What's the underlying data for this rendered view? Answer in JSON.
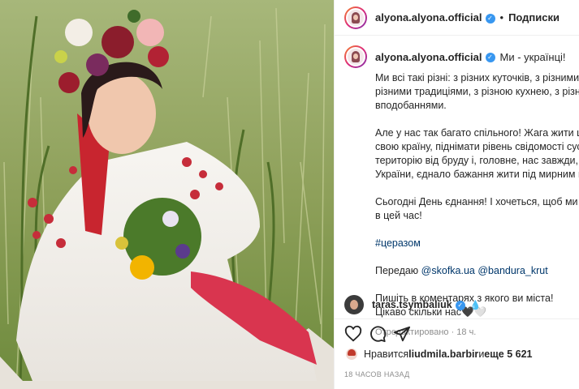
{
  "post": {
    "author": "alyona.alyona.official",
    "follow_label": "Подписки",
    "separator": "•",
    "verified_mark": "✓"
  },
  "caption": {
    "title": "Ми - українці!",
    "lines1": [
      "Ми всі такі різні: з різних куточків, з різними діалектами,",
      "різними традиціями, з різною кухнею, з різними смаками і",
      "вподобаннями."
    ],
    "lines2": [
      "Але у нас так багато спільного! Жага жити щасливо, розвивати",
      "свою країну, піднімати рівень свідомості суспільства, чистити",
      "територію від бруду і, головне, нас завжди, протягом історії",
      "України, єднало бажання жити під мирним небом на своїй землі."
    ],
    "lines3": [
      "Сьогодні День єднання! І хочеться, щоб ми були єдині, як ніколи,",
      "в цей час!"
    ],
    "hashtag": "#церазом",
    "pass_prefix": "Передаю ",
    "mention1": "@skofka.ua",
    "mention2": "@bandura_krut",
    "lines4": [
      "Пишіть в коментарях з якого ви міста!",
      "Цікаво скільки нас🖤🤍"
    ],
    "edited": "Отредактировано · 18 ч."
  },
  "comment": {
    "user": "taras.tsymbaliuk",
    "emoji": "💧"
  },
  "actions": {
    "like_icon": "heart-icon",
    "comment_icon": "comment-icon",
    "share_icon": "share-icon"
  },
  "likes": {
    "prefix": "Нравится ",
    "user": "liudmila.barbir",
    "mid": " и ",
    "count": "еще 5 621"
  },
  "timestamp": "18 ЧАСОВ НАЗАД",
  "colors": {
    "link": "#00376b",
    "verified": "#3897f0",
    "muted": "#8e8e8e"
  }
}
